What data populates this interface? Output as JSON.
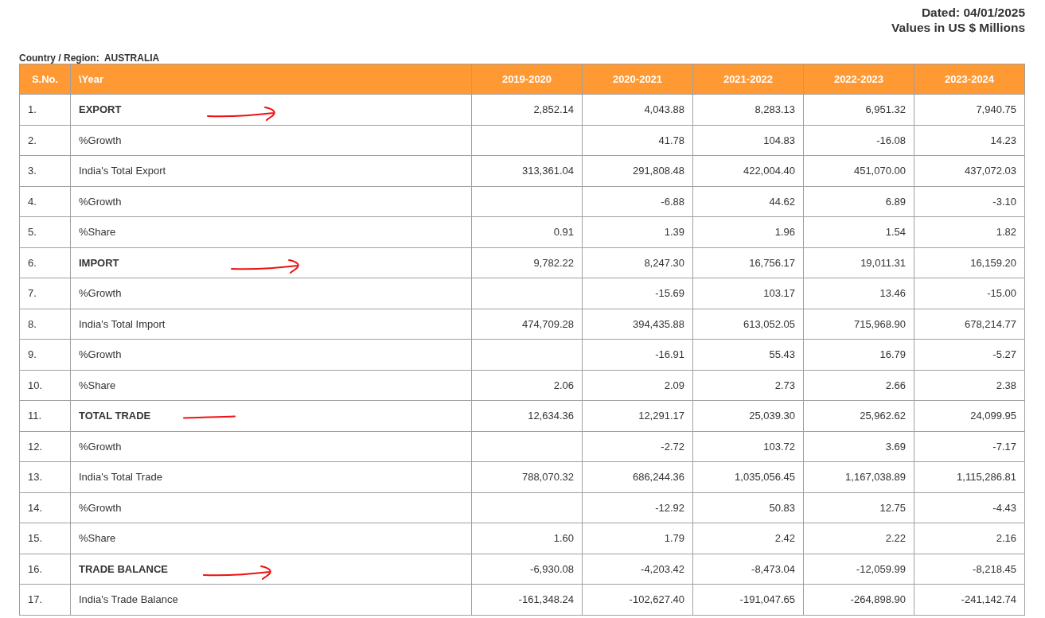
{
  "dated": "Dated: 04/01/2025",
  "units": "Values in US $ Millions",
  "region_label": "Country / Region:",
  "region": "AUSTRALIA",
  "table": {
    "columns": [
      "S.No.",
      "\\Year",
      "2019-2020",
      "2020-2021",
      "2021-2022",
      "2022-2023",
      "2023-2024"
    ],
    "rows": [
      {
        "sno": "1.",
        "label": "EXPORT",
        "kind": "main",
        "annotation": {
          "kind": "arrow"
        },
        "cells": {
          "col_3": "2,852.14",
          "col_4": "4,043.88",
          "col_5": "8,283.13",
          "col_6": "6,951.32",
          "col_7": "7,940.75"
        }
      },
      {
        "sno": "2.",
        "label": "%Growth",
        "kind": "sub",
        "cells": {
          "col_4": "41.78",
          "col_5": "104.83",
          "col_6": "-16.08",
          "col_7": "14.23"
        }
      },
      {
        "sno": "3.",
        "label": "India's Total Export",
        "kind": "sub",
        "cells": {
          "col_3": "313,361.04",
          "col_4": "291,808.48",
          "col_5": "422,004.40",
          "col_6": "451,070.00",
          "col_7": "437,072.03"
        }
      },
      {
        "sno": "4.",
        "label": "%Growth",
        "kind": "sub",
        "cells": {
          "col_4": "-6.88",
          "col_5": "44.62",
          "col_6": "6.89",
          "col_7": "-3.10"
        }
      },
      {
        "sno": "5.",
        "label": "%Share",
        "kind": "sub",
        "cells": {
          "col_3": "0.91",
          "col_4": "1.39",
          "col_5": "1.96",
          "col_6": "1.54",
          "col_7": "1.82"
        }
      },
      {
        "sno": "6.",
        "label": "IMPORT",
        "kind": "main",
        "annotation": {
          "kind": "arrow"
        },
        "cells": {
          "col_3": "9,782.22",
          "col_4": "8,247.30",
          "col_5": "16,756.17",
          "col_6": "19,011.31",
          "col_7": "16,159.20"
        }
      },
      {
        "sno": "7.",
        "label": "%Growth",
        "kind": "sub",
        "cells": {
          "col_4": "-15.69",
          "col_5": "103.17",
          "col_6": "13.46",
          "col_7": "-15.00"
        }
      },
      {
        "sno": "8.",
        "label": "India's Total Import",
        "kind": "sub",
        "cells": {
          "col_3": "474,709.28",
          "col_4": "394,435.88",
          "col_5": "613,052.05",
          "col_6": "715,968.90",
          "col_7": "678,214.77"
        }
      },
      {
        "sno": "9.",
        "label": "%Growth",
        "kind": "sub",
        "cells": {
          "col_4": "-16.91",
          "col_5": "55.43",
          "col_6": "16.79",
          "col_7": "-5.27"
        }
      },
      {
        "sno": "10.",
        "label": "%Share",
        "kind": "sub",
        "cells": {
          "col_3": "2.06",
          "col_4": "2.09",
          "col_5": "2.73",
          "col_6": "2.66",
          "col_7": "2.38"
        }
      },
      {
        "sno": "11.",
        "label": "TOTAL TRADE",
        "kind": "main",
        "annotation": {
          "kind": "line"
        },
        "cells": {
          "col_3": "12,634.36",
          "col_4": "12,291.17",
          "col_5": "25,039.30",
          "col_6": "25,962.62",
          "col_7": "24,099.95"
        }
      },
      {
        "sno": "12.",
        "label": "%Growth",
        "kind": "sub",
        "cells": {
          "col_4": "-2.72",
          "col_5": "103.72",
          "col_6": "3.69",
          "col_7": "-7.17"
        }
      },
      {
        "sno": "13.",
        "label": "India's Total Trade",
        "kind": "sub",
        "cells": {
          "col_3": "788,070.32",
          "col_4": "686,244.36",
          "col_5": "1,035,056.45",
          "col_6": "1,167,038.89",
          "col_7": "1,115,286.81"
        }
      },
      {
        "sno": "14.",
        "label": "%Growth",
        "kind": "sub",
        "cells": {
          "col_4": "-12.92",
          "col_5": "50.83",
          "col_6": "12.75",
          "col_7": "-4.43"
        }
      },
      {
        "sno": "15.",
        "label": "%Share",
        "kind": "sub",
        "cells": {
          "col_3": "1.60",
          "col_4": "1.79",
          "col_5": "2.42",
          "col_6": "2.22",
          "col_7": "2.16"
        }
      },
      {
        "sno": "16.",
        "label": "TRADE BALANCE",
        "kind": "main",
        "annotation": {
          "kind": "arrow"
        },
        "cells": {
          "col_3": "-6,930.08",
          "col_4": "-4,203.42",
          "col_5": "-8,473.04",
          "col_6": "-12,059.99",
          "col_7": "-8,218.45"
        }
      },
      {
        "sno": "17.",
        "label": "India's Trade Balance",
        "kind": "sub",
        "cells": {
          "col_3": "-161,348.24",
          "col_4": "-102,627.40",
          "col_5": "-191,047.65",
          "col_6": "-264,898.90",
          "col_7": "-241,142.74"
        }
      }
    ]
  }
}
